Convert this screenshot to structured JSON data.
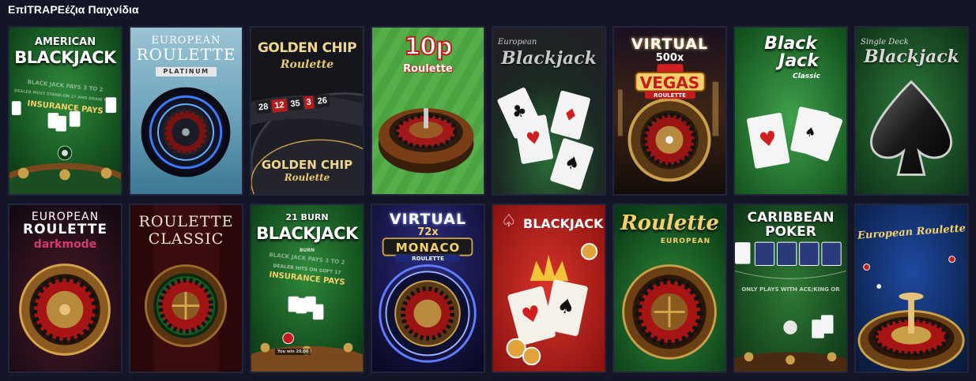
{
  "section": {
    "title": "ΕπITRAPEέζια Παιχνίδια"
  },
  "games": [
    {
      "line1": "AMERICAN",
      "line2": "BLACKJACK",
      "felt1": "BLACK JACK PAYS 3 TO 2",
      "felt2": "DEALER MUST STAND ON 17 AND DRAW TO 16",
      "felt3": "INSURANCE PAYS"
    },
    {
      "line1": "EUROPEAN",
      "line2": "ROULETTE",
      "badge": "PLATINUM"
    },
    {
      "line1": "GOLDEN CHIP",
      "line2": "Roulette",
      "numbers": [
        "28",
        "12",
        "35",
        "3",
        "26"
      ],
      "line3": "GOLDEN CHIP",
      "line4": "Roulette"
    },
    {
      "line1": "10p",
      "line2": "Roulette"
    },
    {
      "line1": "European",
      "line2": "Blackjack"
    },
    {
      "line1": "VIRTUAL",
      "line2": "500x",
      "line3": "VEGAS",
      "line4": "ROULETTE"
    },
    {
      "line1": "Black",
      "line2": "Jack",
      "line3": "Classic"
    },
    {
      "line1": "Single Deck",
      "line2": "Blackjack"
    },
    {
      "line1": "EUROPEAN",
      "line2": "ROULETTE",
      "line3": "darkmode"
    },
    {
      "line1": "ROULETTE",
      "line2": "CLASSIC"
    },
    {
      "line1": "21 BURN",
      "line2": "BLACKJACK",
      "felt1": "BLACK JACK PAYS 3 TO 2",
      "felt2": "DEALER HITS ON SOFT 17",
      "felt3": "INSURANCE PAYS",
      "chip": "BURN",
      "win": "You win 20.00"
    },
    {
      "line1": "VIRTUAL",
      "line2": "72x",
      "line3": "MONACO",
      "line4": "ROULETTE"
    },
    {
      "line1": "BLACKJACK"
    },
    {
      "line1": "Roulette",
      "line2": "EUROPEAN"
    },
    {
      "line1": "CARIBBEAN",
      "line2": "POKER",
      "felt1": "ONLY PLAYS WITH ACE/KING OR"
    },
    {
      "line1": "European Roulette"
    }
  ]
}
